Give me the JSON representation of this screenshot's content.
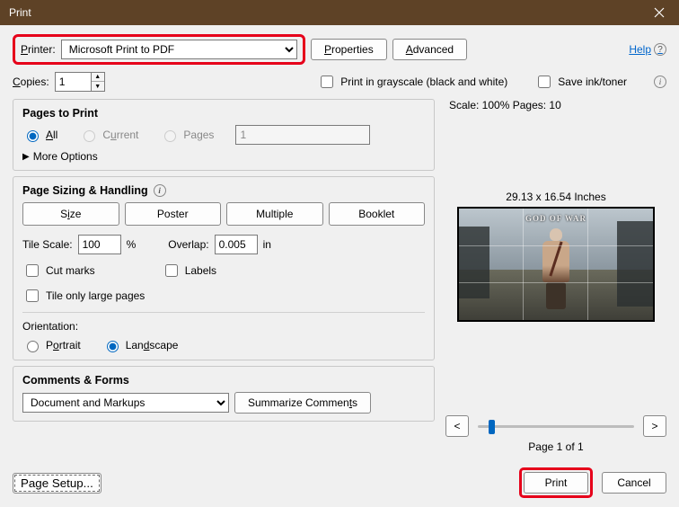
{
  "window": {
    "title": "Print"
  },
  "top": {
    "printer_label": "Printer:",
    "printer_value": "Microsoft Print to PDF",
    "properties_btn": "Properties",
    "advanced_btn": "Advanced",
    "help": "Help"
  },
  "copies": {
    "label": "Copies:",
    "value": "1",
    "grayscale": "Print in grayscale (black and white)",
    "save_ink": "Save ink/toner"
  },
  "pages": {
    "title": "Pages to Print",
    "all": "All",
    "current": "Current",
    "pages_opt": "Pages",
    "pages_value": "1",
    "more": "More Options"
  },
  "sizing": {
    "title": "Page Sizing & Handling",
    "size": "Size",
    "poster": "Poster",
    "multiple": "Multiple",
    "booklet": "Booklet",
    "tile_scale_label": "Tile Scale:",
    "tile_scale_value": "100",
    "percent": "%",
    "overlap_label": "Overlap:",
    "overlap_value": "0.005",
    "overlap_unit": "in",
    "cut_marks": "Cut marks",
    "labels": "Labels",
    "tile_only": "Tile only large pages"
  },
  "orientation": {
    "title": "Orientation:",
    "portrait": "Portrait",
    "landscape": "Landscape"
  },
  "comments": {
    "title": "Comments & Forms",
    "value": "Document and Markups",
    "summarize": "Summarize Comments"
  },
  "preview": {
    "scale_pages": "Scale: 100% Pages: 10",
    "dimensions": "29.13 x 16.54 Inches",
    "logo": "GOD OF WAR",
    "prev": "<",
    "next": ">",
    "page_of": "Page 1 of 1"
  },
  "footer": {
    "page_setup": "Page Setup...",
    "print": "Print",
    "cancel": "Cancel"
  }
}
